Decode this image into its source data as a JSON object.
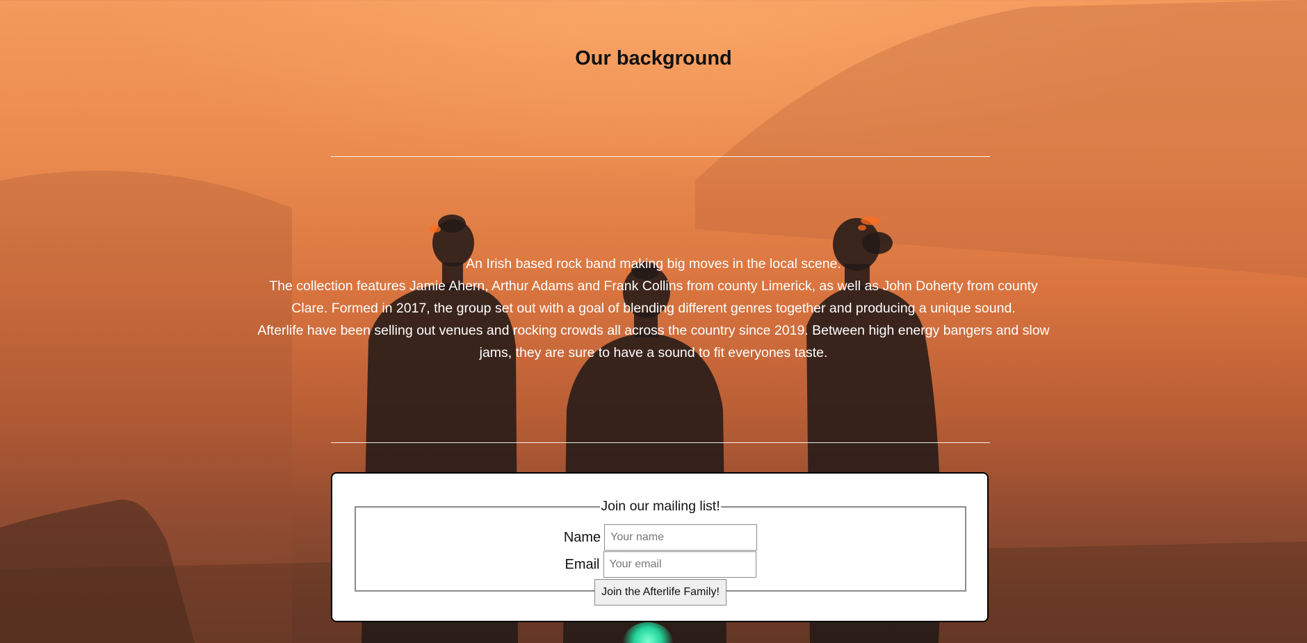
{
  "page": {
    "title": "Our background"
  },
  "about": {
    "lines": [
      "An Irish based rock band making big moves in the local scene.",
      "The collection features Jamie Ahern, Arthur Adams and Frank Collins from county Limerick, as well as John Doherty from county Clare. Formed in 2017, the group set out with a goal of blending different genres together and producing a unique sound.",
      "Afterlife have been selling out venues and rocking crowds all across the country since 2019. Between high energy bangers and slow jams, they are sure to have a sound to fit everyones taste."
    ]
  },
  "mailing_form": {
    "legend": "Join our mailing list!",
    "name_label": "Name",
    "name_placeholder": "Your name",
    "email_label": "Email",
    "email_placeholder": "Your email",
    "submit_label": "Join the Afterlife Family!"
  },
  "colors": {
    "background_top": "#f39a5c",
    "background_bottom": "#6e3b2a",
    "text_light": "#ffffff",
    "text_dark": "#111111",
    "card_bg": "#ffffff",
    "accent_glow": "#22d49a"
  }
}
